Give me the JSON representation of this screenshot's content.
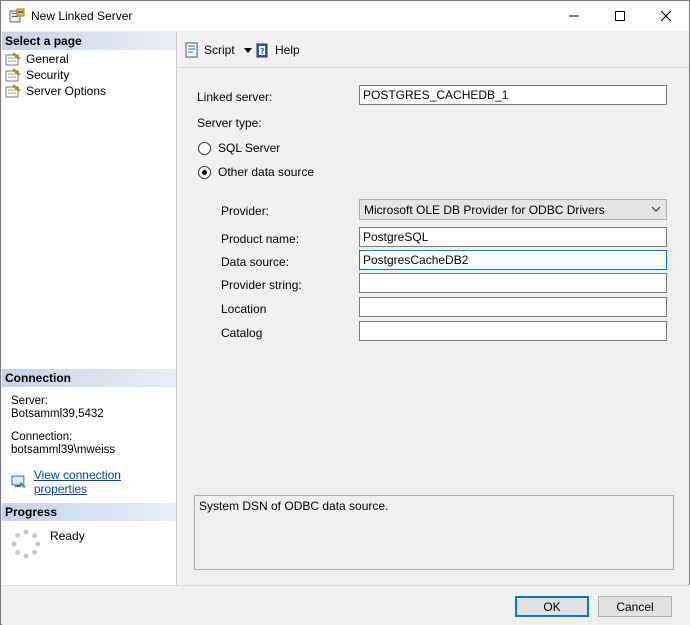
{
  "window": {
    "title": "New Linked Server"
  },
  "left": {
    "select_page_header": "Select a page",
    "pages": [
      {
        "label": "General"
      },
      {
        "label": "Security"
      },
      {
        "label": "Server Options"
      }
    ],
    "connection_header": "Connection",
    "server_label": "Server:",
    "server_value": "Botsamml39,5432",
    "connection_label": "Connection:",
    "connection_value": "botsamml39\\mweiss",
    "view_connection_link": "View connection properties",
    "progress_header": "Progress",
    "progress_status": "Ready"
  },
  "toolbar": {
    "script_label": "Script",
    "help_label": "Help"
  },
  "form": {
    "linked_server_label": "Linked server:",
    "linked_server_value": "POSTGRES_CACHEDB_1",
    "server_type_label": "Server type:",
    "sql_server_label": "SQL Server",
    "other_source_label": "Other data source",
    "provider_label": "Provider:",
    "provider_value": "Microsoft OLE DB Provider for ODBC Drivers",
    "product_name_label": "Product name:",
    "product_name_value": "PostgreSQL",
    "data_source_label": "Data source:",
    "data_source_value": "PostgresCacheDB2",
    "provider_string_label": "Provider string:",
    "provider_string_value": "",
    "location_label": "Location",
    "location_value": "",
    "catalog_label": "Catalog",
    "catalog_value": "",
    "description": "System DSN of ODBC data source."
  },
  "buttons": {
    "ok": "OK",
    "cancel": "Cancel"
  },
  "colors": {
    "accent": "#0078d7",
    "link": "#0645ad",
    "header_gradient_start": "#c5d3e6"
  }
}
